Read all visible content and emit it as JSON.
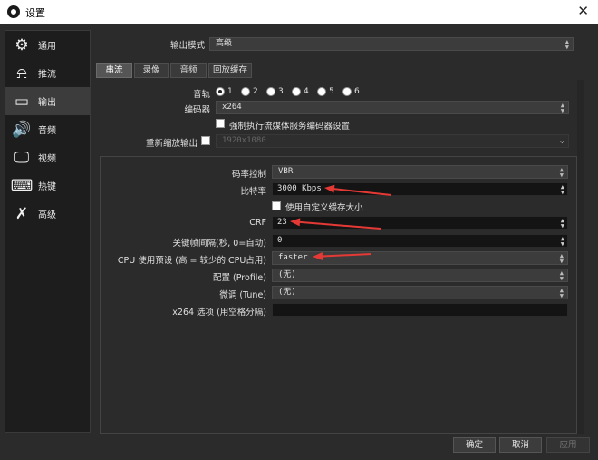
{
  "window": {
    "title": "设置",
    "close": "✕"
  },
  "sidebar": {
    "items": [
      {
        "label": "通用",
        "icon": "gear-icon",
        "glyph": "⚙"
      },
      {
        "label": "推流",
        "icon": "broadcast-icon",
        "glyph": "⍾"
      },
      {
        "label": "输出",
        "icon": "monitor-output-icon",
        "glyph": "▭"
      },
      {
        "label": "音频",
        "icon": "speaker-icon",
        "glyph": "🔊"
      },
      {
        "label": "视频",
        "icon": "monitor-icon",
        "glyph": "🖵"
      },
      {
        "label": "热键",
        "icon": "keyboard-icon",
        "glyph": "⌨"
      },
      {
        "label": "高级",
        "icon": "tools-icon",
        "glyph": "✗"
      }
    ],
    "active_index": 2
  },
  "output_mode": {
    "label": "输出模式",
    "value": "高级"
  },
  "tabs": [
    "串流",
    "录像",
    "音频",
    "回放缓存"
  ],
  "audio_track": {
    "label": "音轨",
    "options": [
      "1",
      "2",
      "3",
      "4",
      "5",
      "6"
    ],
    "selected": "1"
  },
  "encoder": {
    "label": "编码器",
    "value": "x264"
  },
  "enforce_encoder": {
    "label": "强制执行流媒体服务编码器设置"
  },
  "rescale": {
    "label": "重新缩放输出",
    "value": "1920x1080"
  },
  "rate_control": {
    "label": "码率控制",
    "value": "VBR"
  },
  "bitrate": {
    "label": "比特率",
    "value": "3000 Kbps"
  },
  "custom_buffer": {
    "label": "使用自定义缓存大小"
  },
  "crf": {
    "label": "CRF",
    "value": "23"
  },
  "keyframe": {
    "label": "关键帧间隔(秒, 0=自动)",
    "value": "0"
  },
  "cpu_preset": {
    "label": "CPU 使用预设 (高 = 较少的 CPU占用)",
    "value": "faster"
  },
  "profile": {
    "label": "配置 (Profile)",
    "value": "(无)"
  },
  "tune": {
    "label": "微调 (Tune)",
    "value": "(无)"
  },
  "x264_options": {
    "label": "x264 选项 (用空格分隔)",
    "value": ""
  },
  "buttons": {
    "ok": "确定",
    "cancel": "取消",
    "apply": "应用"
  },
  "colors": {
    "annotation_arrow": "#e53935",
    "active_tab": "#555555",
    "sidebar_active": "#3c3c3c"
  }
}
